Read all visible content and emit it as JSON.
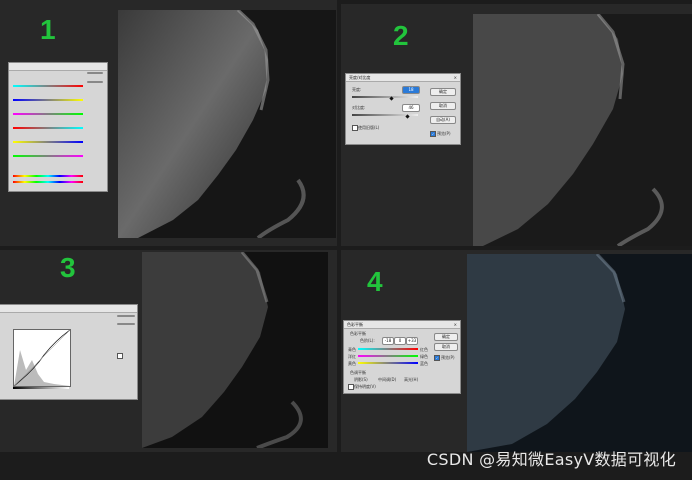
{
  "panels": [
    {
      "number": "1"
    },
    {
      "number": "2"
    },
    {
      "number": "3"
    },
    {
      "number": "4"
    }
  ],
  "dialog2": {
    "title": "亮度/对比度",
    "brightness_label": "亮度:",
    "brightness_value": "18",
    "contrast_label": "对比度:",
    "contrast_value": "46",
    "ok": "确定",
    "cancel": "取消",
    "auto": "自动(A)",
    "legacy": "使用旧版(L)",
    "preview": "预览(P)"
  },
  "dialog4": {
    "title": "色彩平衡",
    "group1": "色彩平衡",
    "levels_label": "色阶(L):",
    "level_values": [
      "-18",
      "0",
      "+33"
    ],
    "left_labels": [
      "青色",
      "洋红",
      "黄色"
    ],
    "right_labels": [
      "红色",
      "绿色",
      "蓝色"
    ],
    "group2": "色调平衡",
    "tones": [
      "阴影(S)",
      "中间调(D)",
      "高光(H)"
    ],
    "keep_lum": "保持明度(V)",
    "ok": "确定",
    "cancel": "取消",
    "preview": "预览(P)"
  },
  "watermark": "CSDN @易知微EasyV数据可视化"
}
